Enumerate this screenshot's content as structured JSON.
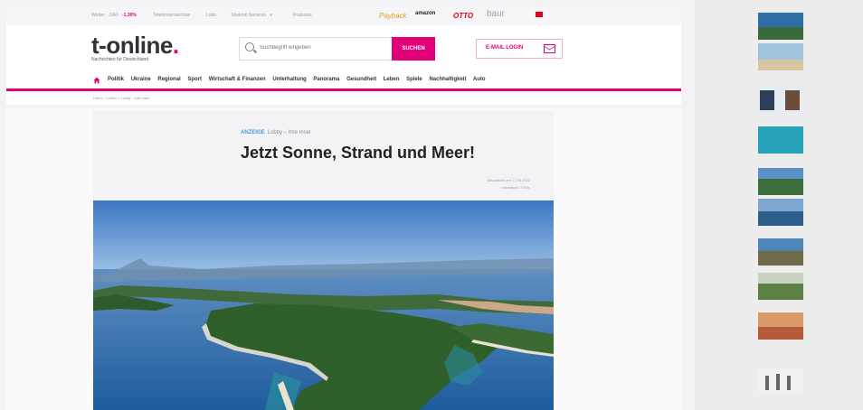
{
  "topbar": {
    "links": [
      "Wetter",
      "DAX",
      "-1,30%",
      "Telefonverzeichnis",
      "Lotto",
      "Telekom Services",
      "Podcasts"
    ],
    "ad_logos": [
      "Payback",
      "amazon",
      "OTTO",
      "baur",
      "flag"
    ]
  },
  "header": {
    "logo_text": "t-online",
    "logo_dot": ".",
    "tagline": "Nachrichten für Deutschland",
    "search_placeholder": "Suchbegriff eingeben",
    "search_button": "SUCHEN",
    "email_login": "E-MAIL LOGIN"
  },
  "nav": {
    "items": [
      "Politik",
      "Ukraine",
      "Regional",
      "Sport",
      "Wirtschaft & Finanzen",
      "Unterhaltung",
      "Panorama",
      "Gesundheit",
      "Leben",
      "Spiele",
      "Nachhaltigkeit",
      "Auto"
    ],
    "more": "· ·"
  },
  "breadcrumb": "Home > Leben > Lobby - Ihre Insel",
  "article": {
    "kicker_label": "ANZEIGE",
    "kicker_text": "Lobby – Ihre Insel",
    "headline": "Jetzt Sonne, Strand und Meer!",
    "meta_updated": "Aktualisiert am 17.05.2022",
    "meta_reading": "Lesedauer: 2 Min."
  },
  "colors": {
    "brand": "#e2007a",
    "text": "#2f3338",
    "link_blue": "#4a9bd1"
  }
}
